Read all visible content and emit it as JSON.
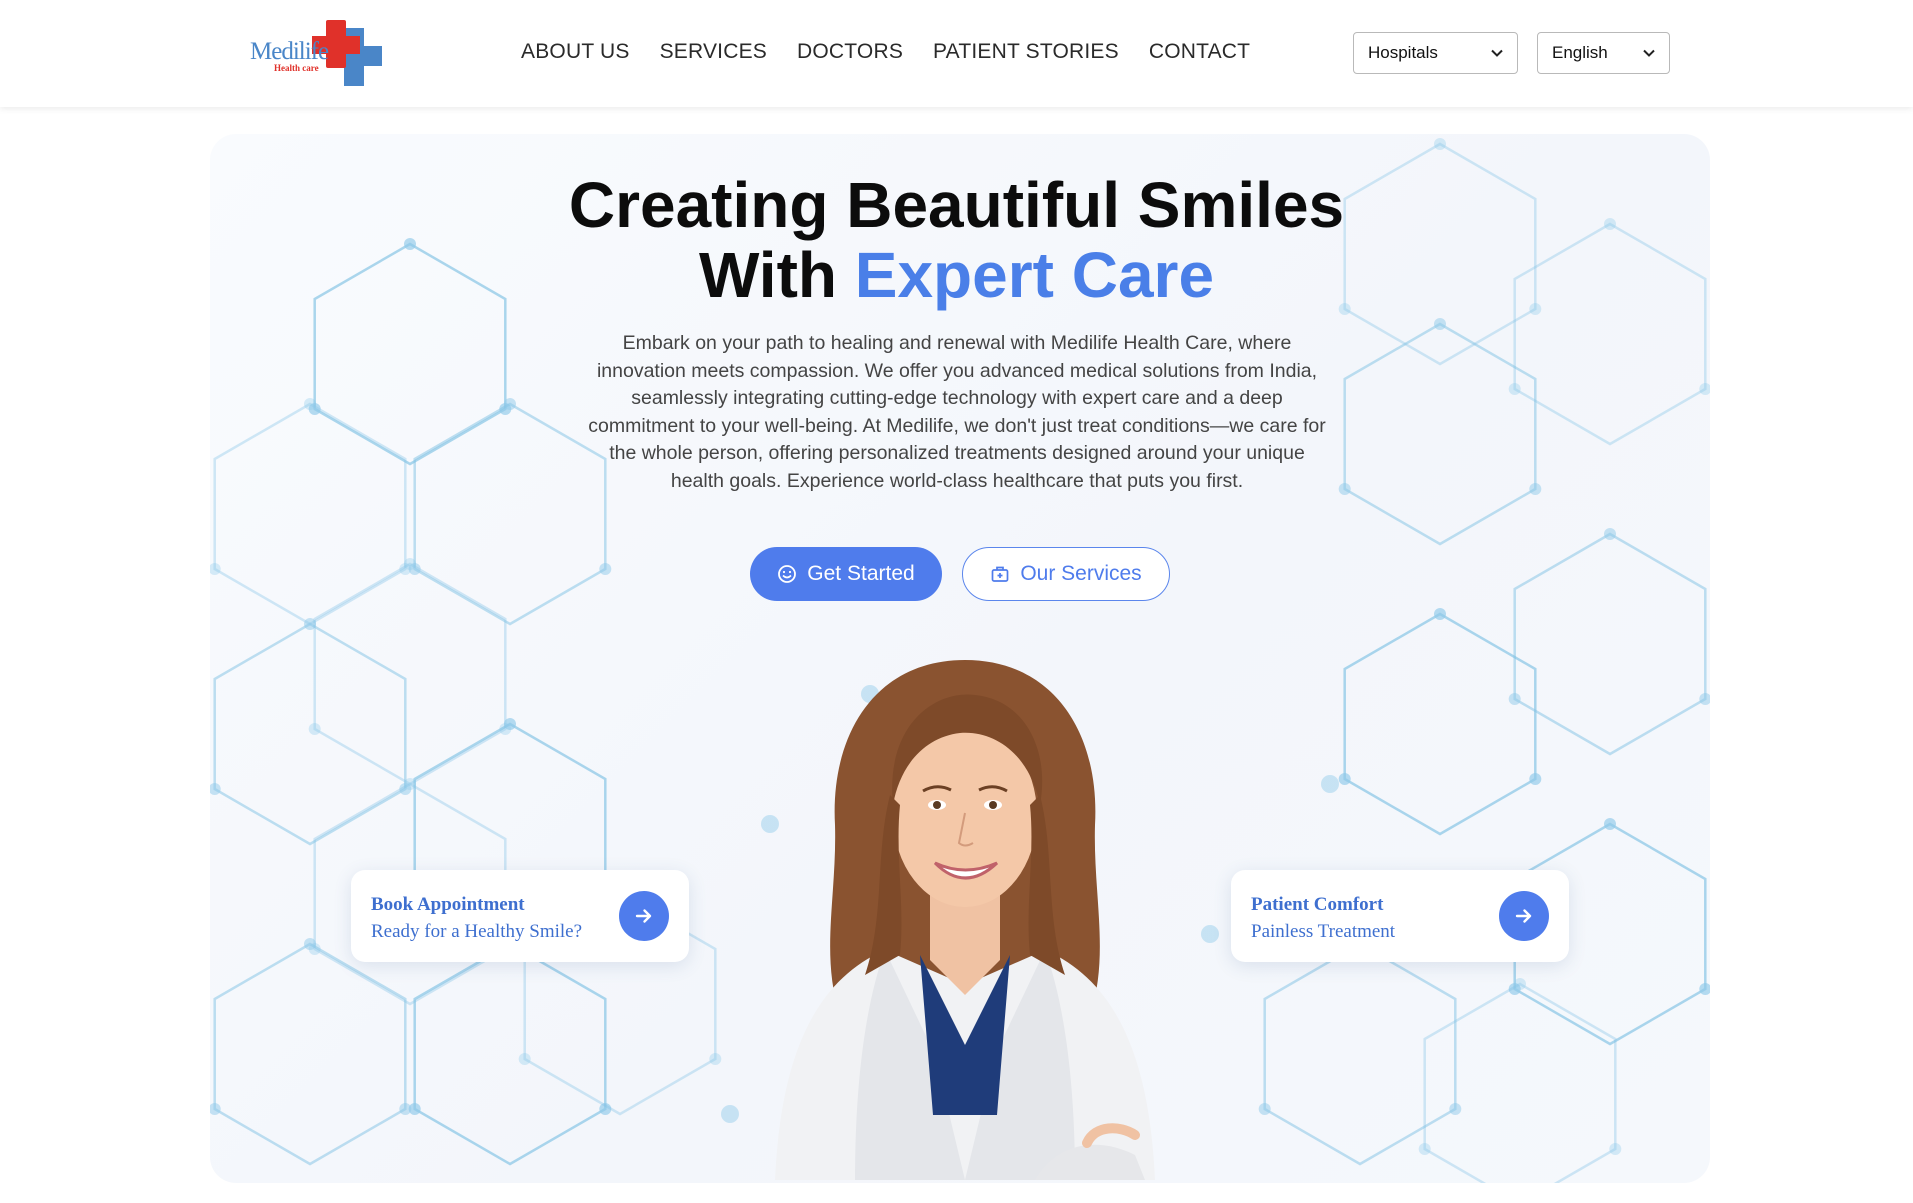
{
  "brand": {
    "name": "Medilife",
    "tagline": "Health care",
    "colors": {
      "red": "#e0312a",
      "blue": "#4a86c8"
    }
  },
  "nav": {
    "items": [
      "ABOUT US",
      "SERVICES",
      "DOCTORS",
      "PATIENT STORIES",
      "CONTACT"
    ]
  },
  "selectors": {
    "hospitals": {
      "selected": "Hospitals",
      "icon": "chevron-down-icon"
    },
    "language": {
      "selected": "English",
      "icon": "chevron-down-icon"
    }
  },
  "hero": {
    "title_line1": "Creating Beautiful Smiles",
    "title_line2_plain": "With ",
    "title_line2_accent": "Expert Care",
    "description": "Embark on your path to healing and renewal with Medilife Health Care, where innovation meets compassion. We offer you advanced medical solutions from India, seamlessly integrating cutting-edge technology with expert care and a deep commitment to your well-being. At Medilife, we don't just treat conditions—we care for the whole person, offering personalized treatments designed around your unique health goals. Experience world-class healthcare that puts you first.",
    "primary_button": {
      "label": "Get Started",
      "icon": "smile-icon"
    },
    "secondary_button": {
      "label": "Our Services",
      "icon": "medical-bag-icon"
    },
    "accent_color": "#4a7fe8"
  },
  "cards": [
    {
      "title": "Book Appointment",
      "subtitle": "Ready for a Healthy Smile?",
      "icon": "arrow-right-icon"
    },
    {
      "title": "Patient Comfort",
      "subtitle": "Painless Treatment",
      "icon": "arrow-right-icon"
    }
  ]
}
